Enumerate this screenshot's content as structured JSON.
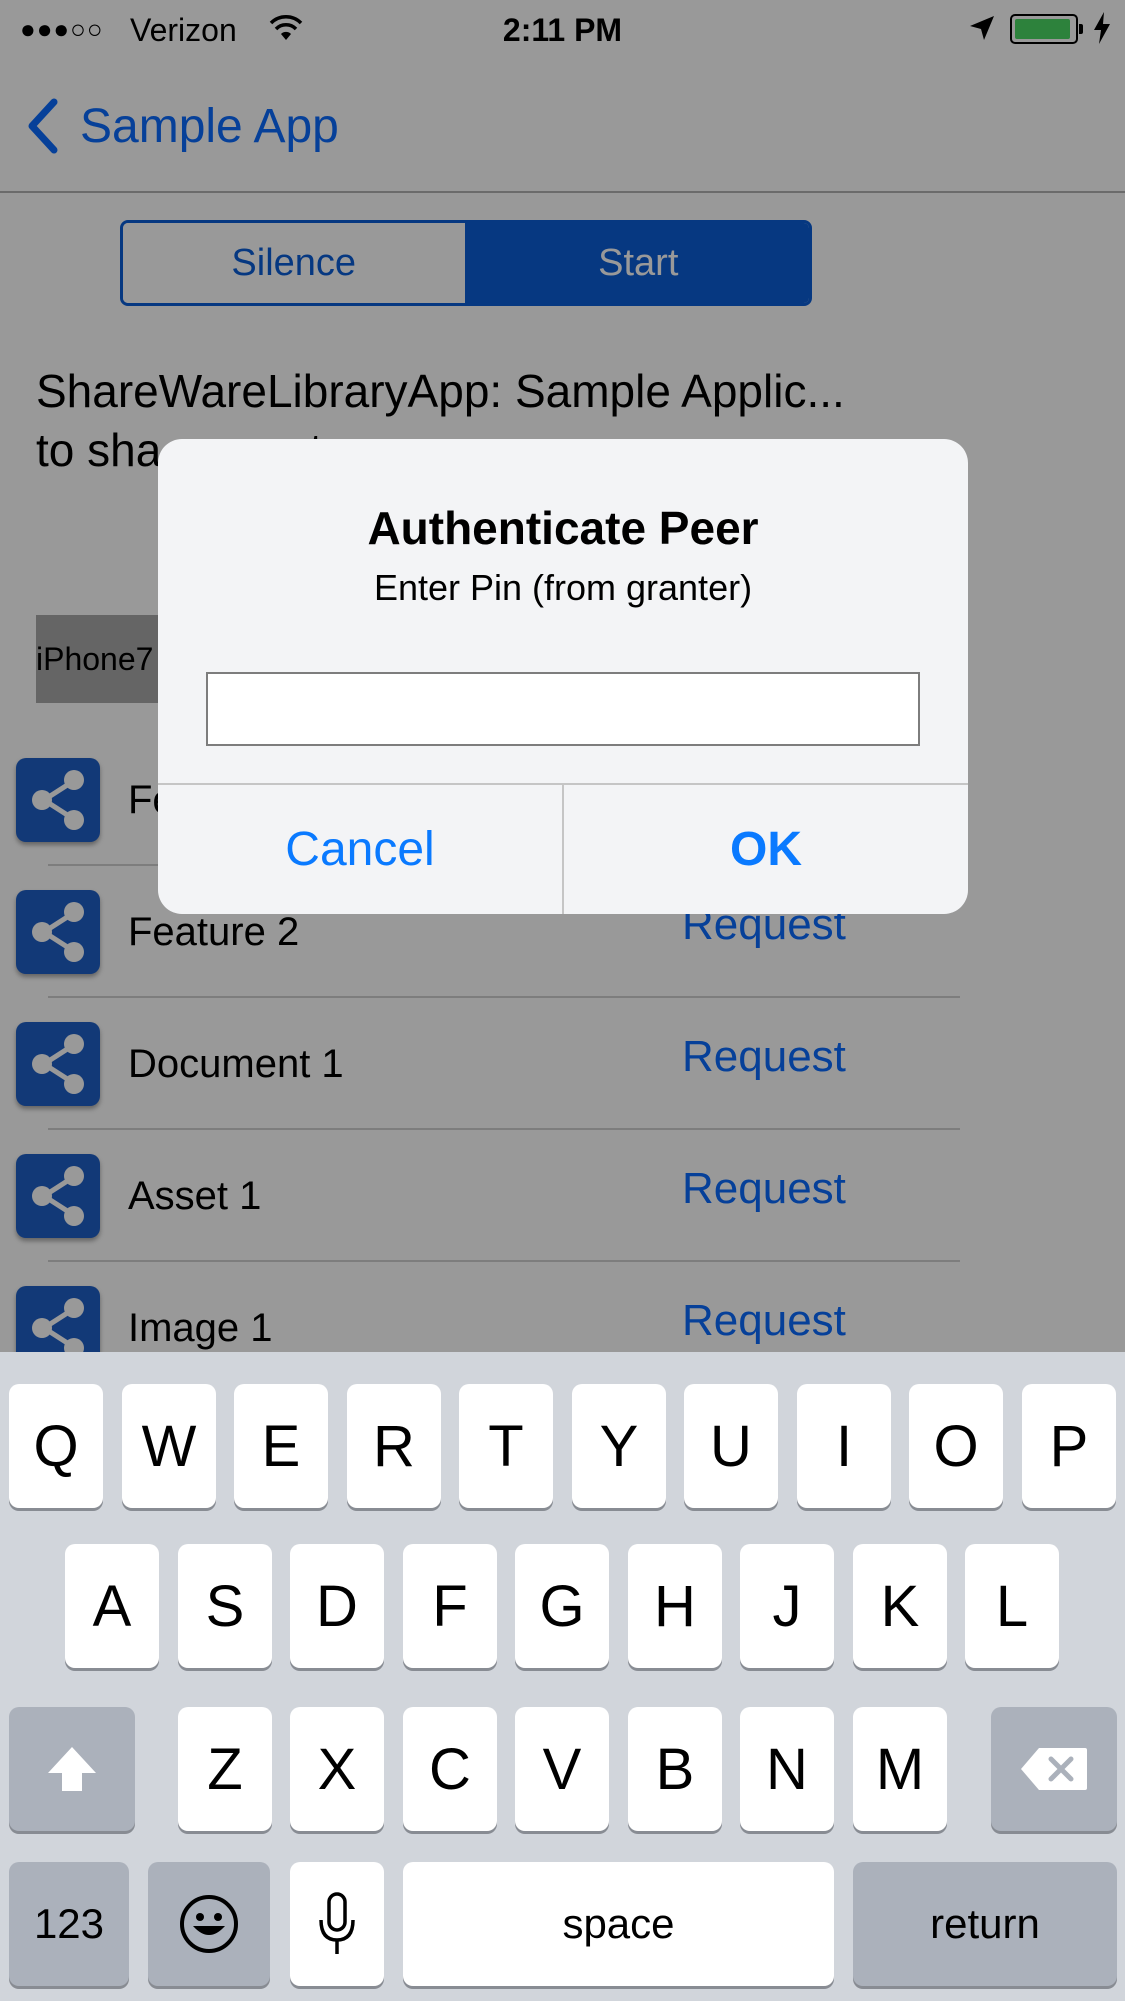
{
  "status_bar": {
    "signal": "●●●○○",
    "carrier": "Verizon",
    "time": "2:11 PM",
    "battery_color": "#4cd964",
    "battery_level": 0.95
  },
  "nav": {
    "back_label": "Sample App"
  },
  "segmented": {
    "options": [
      "Silence",
      "Start"
    ],
    "selected": "Start"
  },
  "description": "ShareWareLibraryApp: Sample Applic... to sha... asset...",
  "device_tag": "iPhone7",
  "list": [
    {
      "label": "Fe",
      "action": ""
    },
    {
      "label": "Feature 2",
      "action": "Request"
    },
    {
      "label": "Document 1",
      "action": "Request"
    },
    {
      "label": "Asset 1",
      "action": "Request"
    },
    {
      "label": "Image 1",
      "action": "Request"
    }
  ],
  "alert": {
    "title": "Authenticate Peer",
    "message": "Enter Pin (from granter)",
    "input_value": "",
    "cancel_label": "Cancel",
    "ok_label": "OK"
  },
  "keyboard": {
    "row1": [
      "Q",
      "W",
      "E",
      "R",
      "T",
      "Y",
      "U",
      "I",
      "O",
      "P"
    ],
    "row2": [
      "A",
      "S",
      "D",
      "F",
      "G",
      "H",
      "J",
      "K",
      "L"
    ],
    "row3": [
      "Z",
      "X",
      "C",
      "V",
      "B",
      "N",
      "M"
    ],
    "numbers_label": "123",
    "space_label": "space",
    "return_label": "return"
  },
  "colors": {
    "accent": "#0a6cff",
    "segment": "#0a5ed8",
    "share_tile": "#1e5fc7",
    "keyboard_bg": "#d1d5db",
    "function_key": "#abb1bb"
  }
}
